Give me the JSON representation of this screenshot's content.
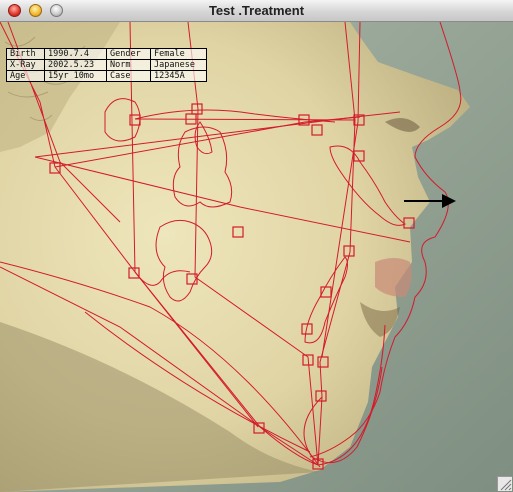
{
  "window": {
    "title": "Test .Treatment"
  },
  "info_table": {
    "rows": [
      {
        "label": "Birth",
        "value": "1990.7.4",
        "label2": "Gender",
        "value2": "Female"
      },
      {
        "label": "X-Ray",
        "value": "2002.5.23",
        "label2": "Norm",
        "value2": "Japanese"
      },
      {
        "label": "Age",
        "value": "15yr 10mo",
        "label2": "Case",
        "value2": "12345A"
      }
    ]
  },
  "overlay": {
    "trace_color": "#d41a2c",
    "arrow_color": "#000000",
    "icons": [
      "skull-tracing",
      "landmark-marker",
      "direction-arrow",
      "resize-grip-icon"
    ]
  },
  "colors": {
    "background_wall": "#9aa89a",
    "skin": "#e3d8a8"
  }
}
